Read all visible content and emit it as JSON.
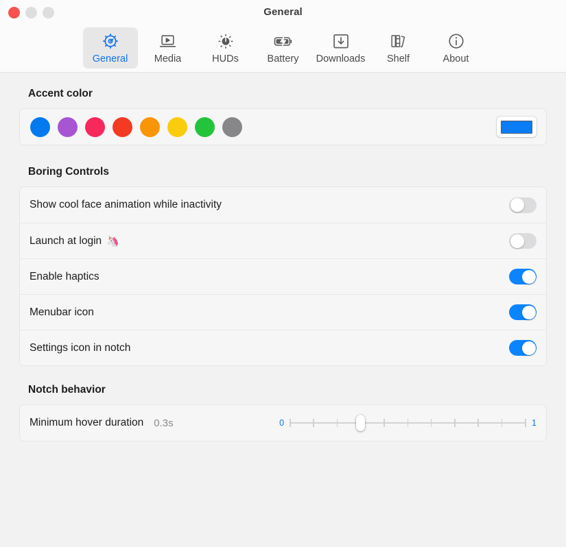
{
  "window": {
    "title": "General",
    "traffic_lights": [
      "close",
      "minimize",
      "zoom"
    ]
  },
  "toolbar": {
    "tabs": [
      {
        "label": "General",
        "icon": "gear-icon",
        "selected": true
      },
      {
        "label": "Media",
        "icon": "media-icon",
        "selected": false
      },
      {
        "label": "HUDs",
        "icon": "hud-dial-icon",
        "selected": false
      },
      {
        "label": "Battery",
        "icon": "battery-icon",
        "selected": false
      },
      {
        "label": "Downloads",
        "icon": "download-icon",
        "selected": false
      },
      {
        "label": "Shelf",
        "icon": "books-icon",
        "selected": false
      },
      {
        "label": "About",
        "icon": "info-icon",
        "selected": false
      }
    ]
  },
  "accent": {
    "heading": "Accent color",
    "colors": [
      {
        "name": "blue",
        "hex": "#057aef"
      },
      {
        "name": "purple",
        "hex": "#a755d2"
      },
      {
        "name": "pink",
        "hex": "#f7285c"
      },
      {
        "name": "red",
        "hex": "#f43a22"
      },
      {
        "name": "orange",
        "hex": "#fa9505"
      },
      {
        "name": "yellow",
        "hex": "#fbcb0d"
      },
      {
        "name": "green",
        "hex": "#23c43c"
      },
      {
        "name": "gray",
        "hex": "#878789"
      }
    ],
    "selected": "blue",
    "color_well_value": "#0a7cf5"
  },
  "boring_controls": {
    "heading": "Boring Controls",
    "rows": [
      {
        "label": "Show cool face animation while inactivity",
        "emoji": "",
        "state": "off"
      },
      {
        "label": "Launch at login",
        "emoji": "🦄",
        "state": "off"
      },
      {
        "label": "Enable haptics",
        "emoji": "",
        "state": "on"
      },
      {
        "label": "Menubar icon",
        "emoji": "",
        "state": "on"
      },
      {
        "label": "Settings icon in notch",
        "emoji": "",
        "state": "on"
      }
    ]
  },
  "notch_behavior": {
    "heading": "Notch behavior",
    "slider": {
      "label": "Minimum hover duration",
      "value_text": "0.3s",
      "min_label": "0",
      "max_label": "1",
      "value": 0.3,
      "min": 0,
      "max": 1,
      "tick_count": 11
    }
  }
}
